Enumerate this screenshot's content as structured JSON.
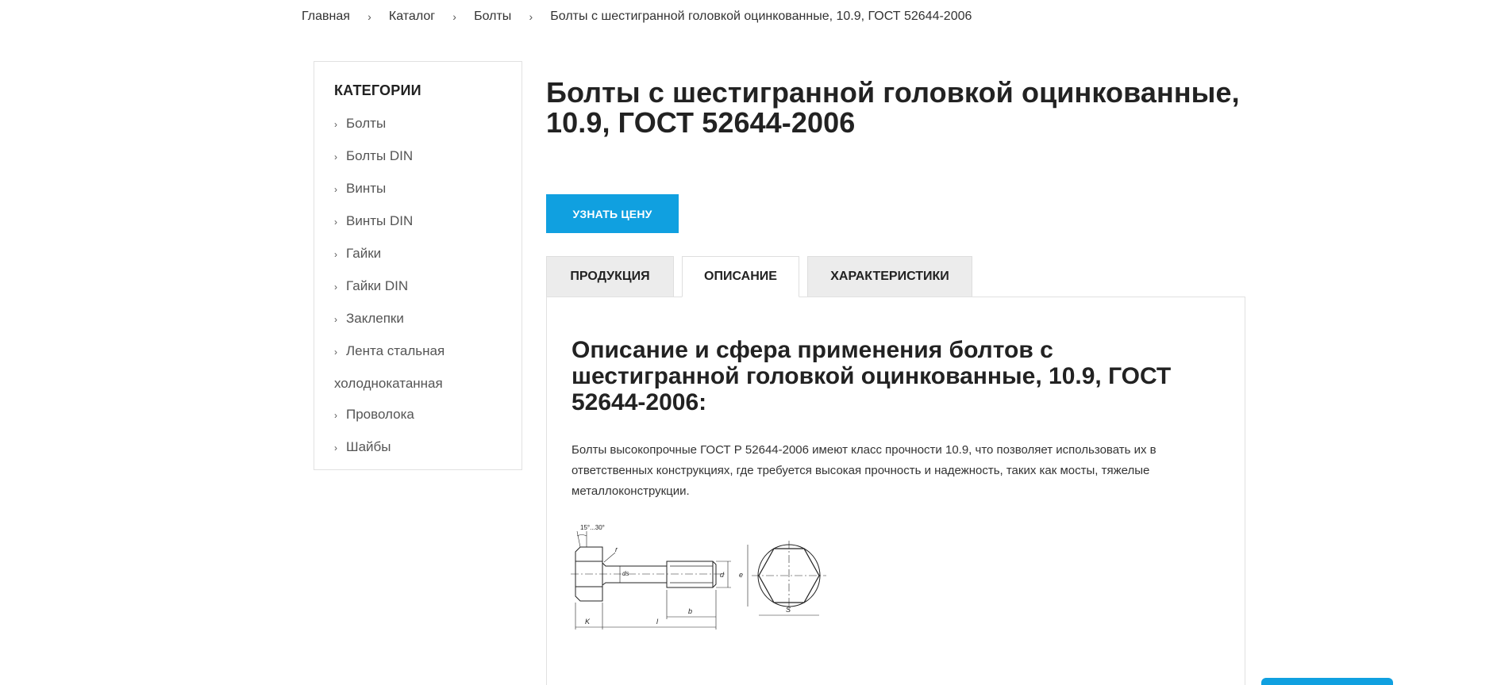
{
  "breadcrumb": {
    "items": [
      "Главная",
      "Каталог",
      "Болты",
      "Болты с шестигранной головкой оцинкованные, 10.9, ГОСТ 52644-2006"
    ],
    "separator": "›"
  },
  "sidebar": {
    "title": "КАТЕГОРИИ",
    "items": [
      "Болты",
      "Болты DIN",
      "Винты",
      "Винты DIN",
      "Гайки",
      "Гайки DIN",
      "Заклепки",
      "Лента стальная",
      "Проволока",
      "Шайбы"
    ],
    "wrap_text": "холоднокатанная"
  },
  "product": {
    "title": "Болты с шестигранной головкой оцинкованные, 10.9, ГОСТ 52644-2006",
    "price_button": "УЗНАТЬ ЦЕНУ"
  },
  "tabs": [
    "ПРОДУКЦИЯ",
    "ОПИСАНИЕ",
    "ХАРАКТЕРИСТИКИ"
  ],
  "description": {
    "heading": "Описание и сфера применения болтов с шестигранной головкой оцинкованные, 10.9, ГОСТ 52644-2006:",
    "text": "Болты высокопрочные ГОСТ Р 52644-2006 имеют класс прочности 10.9, что позволяет использовать их в ответственных конструкциях, где требуется высокая прочность и надежность, таких как мосты, тяжелые металлоконструкции."
  },
  "drawing": {
    "labels": {
      "angle": "15°...30°",
      "r": "r",
      "ds": "ds",
      "d": "d",
      "e": "e",
      "k": "K",
      "l": "l",
      "b": "b",
      "s": "S"
    }
  },
  "colors": {
    "accent": "#10a0e0",
    "tab_inactive": "#ececec",
    "border": "#e1e1e1"
  }
}
